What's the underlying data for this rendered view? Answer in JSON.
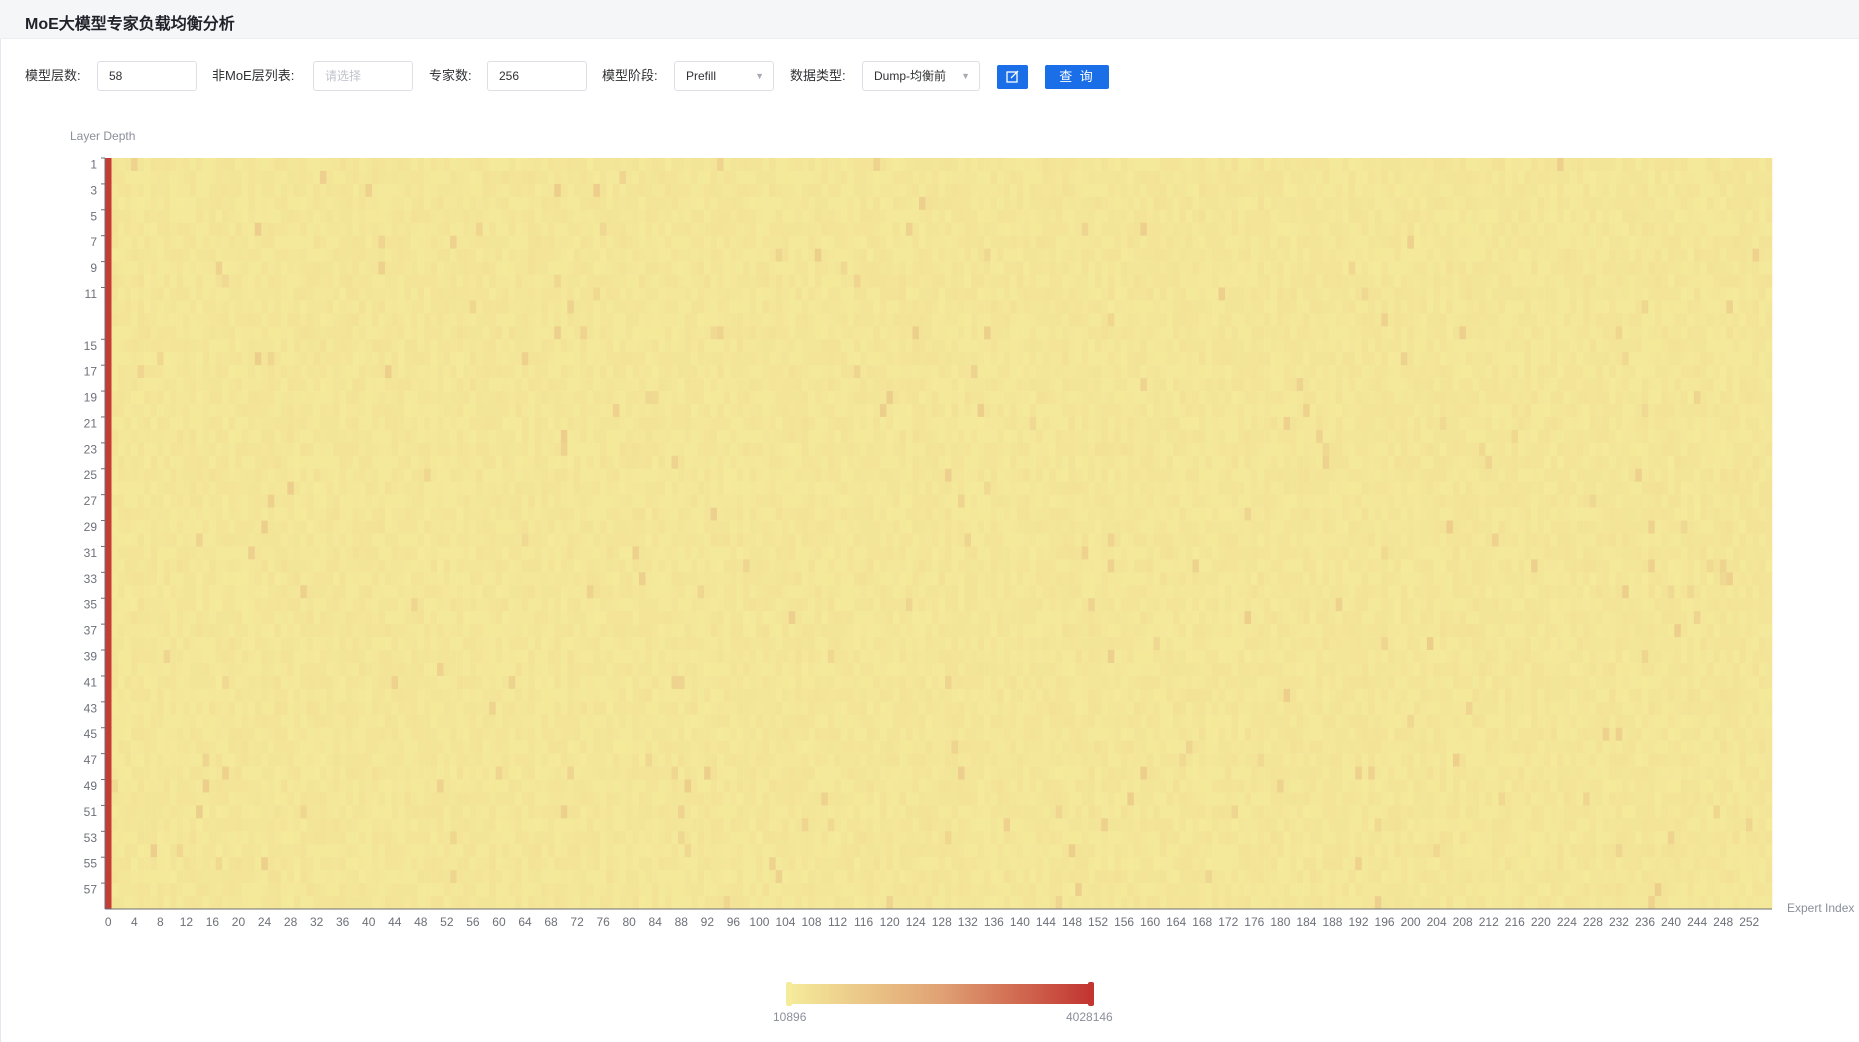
{
  "header": {
    "title": "MoE大模型专家负载均衡分析"
  },
  "form": {
    "layers_label": "模型层数:",
    "layers_value": "58",
    "non_moe_label": "非MoE层列表:",
    "non_moe_placeholder": "请选择",
    "experts_label": "专家数:",
    "experts_value": "256",
    "stage_label": "模型阶段:",
    "stage_value": "Prefill",
    "dtype_label": "数据类型:",
    "dtype_value": "Dump-均衡前",
    "query_label": "查 询"
  },
  "icons": {
    "edit": "edit-icon",
    "dropdown": "chevron-down-icon"
  },
  "colors": {
    "primary": "#1a6fe8",
    "low": "#f5eb9b",
    "high": "#c23531"
  },
  "chart_data": {
    "type": "heatmap",
    "ylabel": "Layer Depth",
    "xlabel": "Expert Index",
    "y_ticks": [
      "1",
      "3",
      "5",
      "7",
      "9",
      "11",
      "15",
      "17",
      "19",
      "21",
      "23",
      "25",
      "27",
      "29",
      "31",
      "33",
      "35",
      "37",
      "39",
      "41",
      "43",
      "45",
      "47",
      "49",
      "51",
      "53",
      "55",
      "57"
    ],
    "x_ticks": [
      "0",
      "4",
      "8",
      "12",
      "16",
      "20",
      "24",
      "28",
      "32",
      "36",
      "40",
      "44",
      "48",
      "52",
      "56",
      "60",
      "64",
      "68",
      "72",
      "76",
      "80",
      "84",
      "88",
      "92",
      "96",
      "100",
      "104",
      "108",
      "112",
      "116",
      "120",
      "124",
      "128",
      "132",
      "136",
      "140",
      "144",
      "148",
      "152",
      "156",
      "160",
      "164",
      "168",
      "172",
      "176",
      "180",
      "184",
      "188",
      "192",
      "196",
      "200",
      "204",
      "208",
      "212",
      "216",
      "220",
      "224",
      "228",
      "232",
      "236",
      "240",
      "244",
      "248",
      "252"
    ],
    "rows": 58,
    "cols": 256,
    "visual_map": {
      "min": "10896",
      "max": "4028146"
    },
    "note_values": "Expert 0 has maximum load (~4028146) in every layer; all other experts have near-minimum load with slight variation."
  }
}
